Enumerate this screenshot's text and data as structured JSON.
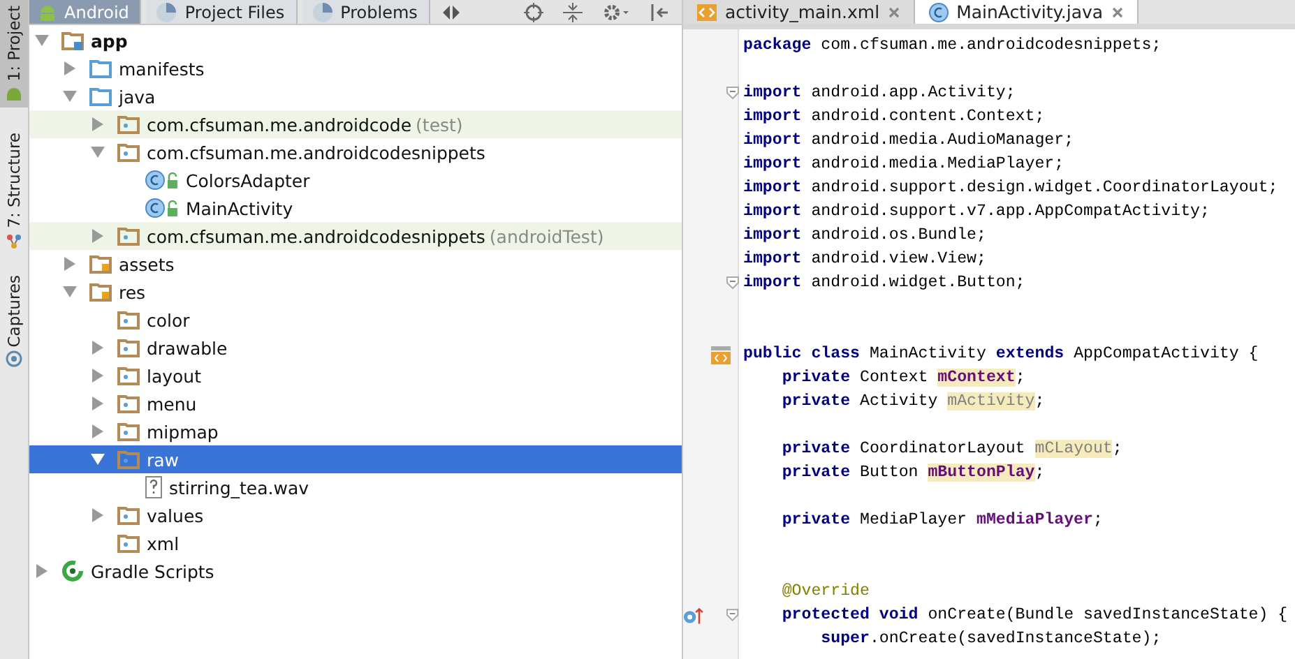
{
  "side_tabs": [
    {
      "label": "1: Project",
      "selected": true
    },
    {
      "label": "7: Structure",
      "selected": false
    },
    {
      "label": "Captures",
      "selected": false
    }
  ],
  "project_tabs": [
    {
      "label": "Android",
      "selected": true
    },
    {
      "label": "Project Files",
      "selected": false
    },
    {
      "label": "Problems",
      "selected": false
    }
  ],
  "tree": [
    {
      "label": "app",
      "kind": "module",
      "expanded": true,
      "selected": false,
      "highlighted": false,
      "children": [
        {
          "label": "manifests",
          "kind": "folder",
          "expanded": false,
          "selected": false,
          "highlighted": false
        },
        {
          "label": "java",
          "kind": "folder",
          "expanded": true,
          "selected": false,
          "highlighted": false,
          "children": [
            {
              "label": "com.cfsuman.me.androidcode",
              "suffix": "(test)",
              "kind": "package",
              "expanded": false,
              "selected": false,
              "highlighted": true
            },
            {
              "label": "com.cfsuman.me.androidcodesnippets",
              "kind": "package",
              "expanded": true,
              "selected": false,
              "highlighted": false,
              "children": [
                {
                  "label": "ColorsAdapter",
                  "kind": "class",
                  "selected": false,
                  "highlighted": false
                },
                {
                  "label": "MainActivity",
                  "kind": "class",
                  "selected": false,
                  "highlighted": false
                }
              ]
            },
            {
              "label": "com.cfsuman.me.androidcodesnippets",
              "suffix": "(androidTest)",
              "kind": "package",
              "expanded": false,
              "selected": false,
              "highlighted": true
            }
          ]
        },
        {
          "label": "assets",
          "kind": "resroot",
          "expanded": false,
          "selected": false,
          "highlighted": false
        },
        {
          "label": "res",
          "kind": "resroot",
          "expanded": true,
          "selected": false,
          "highlighted": false,
          "children": [
            {
              "label": "color",
              "kind": "package",
              "selected": false,
              "highlighted": false
            },
            {
              "label": "drawable",
              "kind": "package",
              "expanded": false,
              "selected": false,
              "highlighted": false
            },
            {
              "label": "layout",
              "kind": "package",
              "expanded": false,
              "selected": false,
              "highlighted": false
            },
            {
              "label": "menu",
              "kind": "package",
              "expanded": false,
              "selected": false,
              "highlighted": false
            },
            {
              "label": "mipmap",
              "kind": "package",
              "expanded": false,
              "selected": false,
              "highlighted": false
            },
            {
              "label": "raw",
              "kind": "package",
              "expanded": true,
              "selected": true,
              "highlighted": false,
              "children": [
                {
                  "label": "stirring_tea.wav",
                  "kind": "file",
                  "selected": false,
                  "highlighted": false
                }
              ]
            },
            {
              "label": "values",
              "kind": "package",
              "expanded": false,
              "selected": false,
              "highlighted": false
            },
            {
              "label": "xml",
              "kind": "package",
              "selected": false,
              "highlighted": false
            }
          ]
        }
      ]
    },
    {
      "label": "Gradle Scripts",
      "kind": "gradle",
      "expanded": false,
      "selected": false,
      "highlighted": false
    }
  ],
  "editor_tabs": [
    {
      "label": "activity_main.xml",
      "kind": "xml",
      "selected": false
    },
    {
      "label": "MainActivity.java",
      "kind": "java",
      "selected": true
    }
  ],
  "code": [
    {
      "kind": "plain",
      "tokens": [
        {
          "text": "package",
          "kind": "keyword"
        },
        {
          "text": " com.cfsuman.me.androidcodesnippets;",
          "kind": "plain"
        }
      ]
    },
    {
      "kind": "blank"
    },
    {
      "kind": "fold",
      "tokens": [
        {
          "text": "import",
          "kind": "keyword"
        },
        {
          "text": " android.app.Activity;",
          "kind": "plain"
        }
      ]
    },
    {
      "kind": "plain",
      "tokens": [
        {
          "text": "import",
          "kind": "keyword"
        },
        {
          "text": " android.content.Context;",
          "kind": "plain"
        }
      ]
    },
    {
      "kind": "plain",
      "tokens": [
        {
          "text": "import",
          "kind": "keyword"
        },
        {
          "text": " android.media.AudioManager;",
          "kind": "plain"
        }
      ]
    },
    {
      "kind": "plain",
      "tokens": [
        {
          "text": "import",
          "kind": "keyword"
        },
        {
          "text": " android.media.MediaPlayer;",
          "kind": "plain"
        }
      ]
    },
    {
      "kind": "plain",
      "tokens": [
        {
          "text": "import",
          "kind": "keyword"
        },
        {
          "text": " android.support.design.widget.CoordinatorLayout;",
          "kind": "plain"
        }
      ]
    },
    {
      "kind": "plain",
      "tokens": [
        {
          "text": "import",
          "kind": "keyword"
        },
        {
          "text": " android.support.v7.app.AppCompatActivity;",
          "kind": "plain"
        }
      ]
    },
    {
      "kind": "plain",
      "tokens": [
        {
          "text": "import",
          "kind": "keyword"
        },
        {
          "text": " android.os.Bundle;",
          "kind": "plain"
        }
      ]
    },
    {
      "kind": "plain",
      "tokens": [
        {
          "text": "import",
          "kind": "keyword"
        },
        {
          "text": " android.view.View;",
          "kind": "plain"
        }
      ]
    },
    {
      "kind": "fold",
      "tokens": [
        {
          "text": "import",
          "kind": "keyword"
        },
        {
          "text": " android.widget.Button;",
          "kind": "plain"
        }
      ]
    },
    {
      "kind": "blank"
    },
    {
      "kind": "blank"
    },
    {
      "kind": "layout",
      "tokens": [
        {
          "text": "public class",
          "kind": "keyword"
        },
        {
          "text": " MainActivity ",
          "kind": "plain"
        },
        {
          "text": "extends",
          "kind": "keyword"
        },
        {
          "text": " AppCompatActivity {",
          "kind": "plain"
        }
      ]
    },
    {
      "kind": "plain",
      "tokens": [
        {
          "text": "    private",
          "kind": "keyword"
        },
        {
          "text": " Context ",
          "kind": "plain"
        },
        {
          "text": "mContext",
          "kind": "field_warn"
        },
        {
          "text": ";",
          "kind": "plain"
        }
      ]
    },
    {
      "kind": "plain",
      "tokens": [
        {
          "text": "    private",
          "kind": "keyword"
        },
        {
          "text": " Activity ",
          "kind": "plain"
        },
        {
          "text": "mActivity",
          "kind": "unused"
        },
        {
          "text": ";",
          "kind": "plain"
        }
      ]
    },
    {
      "kind": "blank"
    },
    {
      "kind": "plain",
      "tokens": [
        {
          "text": "    private",
          "kind": "keyword"
        },
        {
          "text": " CoordinatorLayout ",
          "kind": "plain"
        },
        {
          "text": "mCLayout",
          "kind": "unused"
        },
        {
          "text": ";",
          "kind": "plain"
        }
      ]
    },
    {
      "kind": "plain",
      "tokens": [
        {
          "text": "    private",
          "kind": "keyword"
        },
        {
          "text": " Button ",
          "kind": "plain"
        },
        {
          "text": "mButtonPlay",
          "kind": "field_warn"
        },
        {
          "text": ";",
          "kind": "plain"
        }
      ]
    },
    {
      "kind": "blank"
    },
    {
      "kind": "plain",
      "tokens": [
        {
          "text": "    private",
          "kind": "keyword"
        },
        {
          "text": " MediaPlayer ",
          "kind": "plain"
        },
        {
          "text": "mMediaPlayer",
          "kind": "field"
        },
        {
          "text": ";",
          "kind": "plain"
        }
      ]
    },
    {
      "kind": "blank"
    },
    {
      "kind": "blank"
    },
    {
      "kind": "plain",
      "tokens": [
        {
          "text": "    @Override",
          "kind": "annotation"
        }
      ]
    },
    {
      "kind": "override",
      "tokens": [
        {
          "text": "    protected void",
          "kind": "keyword"
        },
        {
          "text": " onCreate(Bundle savedInstanceState) {",
          "kind": "plain"
        }
      ]
    },
    {
      "kind": "plain",
      "tokens": [
        {
          "text": "        super",
          "kind": "keyword"
        },
        {
          "text": ".onCreate(savedInstanceState);",
          "kind": "plain"
        }
      ]
    }
  ]
}
